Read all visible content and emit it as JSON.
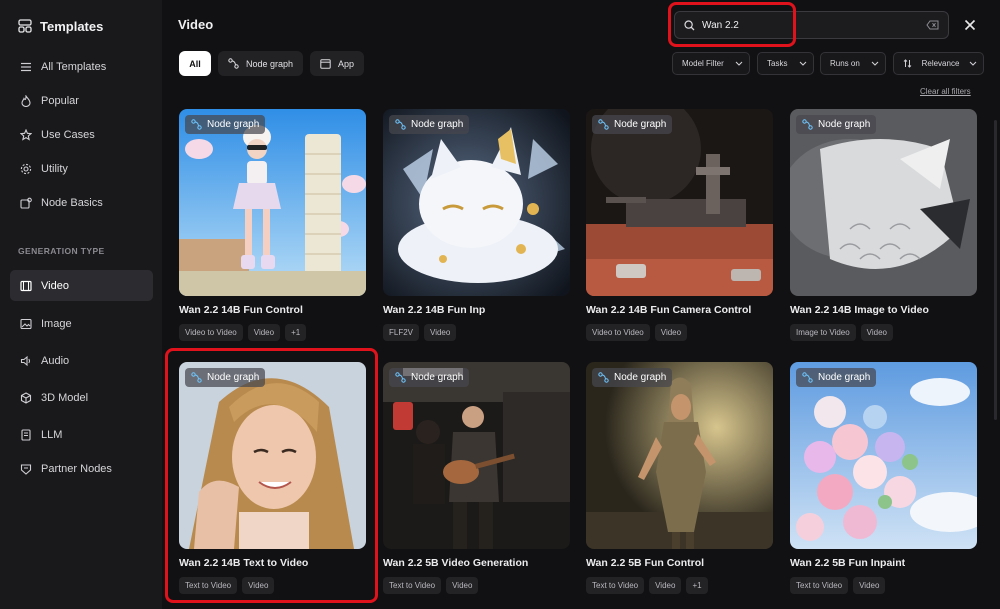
{
  "sidebar": {
    "brand": "Templates",
    "items": [
      {
        "label": "All Templates"
      },
      {
        "label": "Popular"
      },
      {
        "label": "Use Cases"
      },
      {
        "label": "Utility"
      },
      {
        "label": "Node Basics"
      }
    ],
    "section_label": "GENERATION TYPE",
    "types": [
      {
        "label": "Video",
        "active": true
      },
      {
        "label": "Image"
      },
      {
        "label": "Audio"
      },
      {
        "label": "3D Model"
      },
      {
        "label": "LLM"
      },
      {
        "label": "Partner Nodes"
      }
    ]
  },
  "header": {
    "title": "Video",
    "search_value": "Wan 2.2"
  },
  "view_chips": [
    {
      "label": "All",
      "active": true
    },
    {
      "label": "Node graph"
    },
    {
      "label": "App"
    }
  ],
  "filters": [
    {
      "label": "Model Filter"
    },
    {
      "label": "Tasks"
    },
    {
      "label": "Runs on"
    },
    {
      "label": "Relevance"
    }
  ],
  "clear_filters": "Clear all filters",
  "badge_label": "Node graph",
  "cards": [
    {
      "title": "Wan 2.2 14B Fun Control",
      "tags": [
        "Video to Video",
        "Video",
        "+1"
      ]
    },
    {
      "title": "Wan 2.2 14B Fun Inp",
      "tags": [
        "FLF2V",
        "Video"
      ]
    },
    {
      "title": "Wan 2.2 14B Fun Camera Control",
      "tags": [
        "Video to Video",
        "Video"
      ]
    },
    {
      "title": "Wan 2.2 14B Image to Video",
      "tags": [
        "Image to Video",
        "Video"
      ]
    },
    {
      "title": "Wan 2.2 14B Text to Video",
      "tags": [
        "Text to Video",
        "Video"
      ]
    },
    {
      "title": "Wan 2.2 5B Video Generation",
      "tags": [
        "Text to Video",
        "Video"
      ]
    },
    {
      "title": "Wan 2.2 5B Fun Control",
      "tags": [
        "Text to Video",
        "Video",
        "+1"
      ]
    },
    {
      "title": "Wan 2.2 5B Fun Inpaint",
      "tags": [
        "Text to Video",
        "Video"
      ]
    }
  ],
  "colors": {
    "accent_highlight": "#e0131c",
    "sidebar_bg": "#19191b",
    "main_bg": "#111113",
    "badge_icon": "#6ec6ff"
  }
}
